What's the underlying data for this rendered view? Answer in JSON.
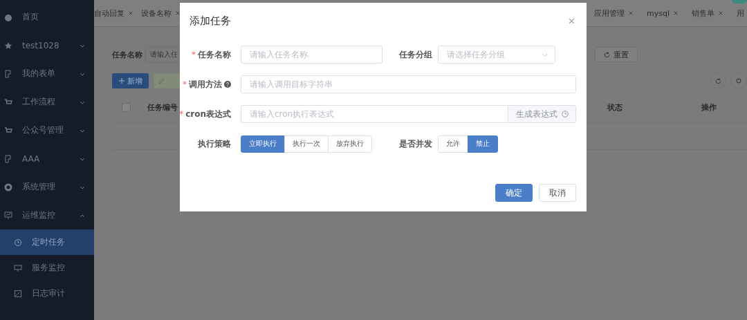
{
  "sidebar": {
    "items": [
      {
        "label": "首页"
      },
      {
        "label": "test1028",
        "expanded": false
      },
      {
        "label": "我的表单",
        "expanded": false
      },
      {
        "label": "工作流程",
        "expanded": false
      },
      {
        "label": "公众号管理",
        "expanded": false
      },
      {
        "label": "AAA",
        "expanded": false
      },
      {
        "label": "系统管理",
        "expanded": false
      },
      {
        "label": "运维监控",
        "expanded": true,
        "children": [
          {
            "label": "定时任务",
            "selected": true
          },
          {
            "label": "服务监控",
            "selected": false
          },
          {
            "label": "日志审计",
            "selected": false
          }
        ]
      }
    ]
  },
  "tabs_start": [
    {
      "label": "自动回复"
    },
    {
      "label": "设备名称"
    }
  ],
  "tabs_end": [
    {
      "label": "应用管理"
    },
    {
      "label": "mysql"
    },
    {
      "label": "销售单"
    },
    {
      "label": "用"
    }
  ],
  "search": {
    "label": "任务名称",
    "placeholder": "请输入任"
  },
  "reset_button": "重置",
  "add_button": "新增",
  "table": {
    "select_all_checked": false,
    "columns": [
      "任务编号",
      "状态",
      "操作"
    ]
  },
  "dialog": {
    "title": "添加任务",
    "rows": [
      [
        {
          "kind": "input",
          "required_mark": "*",
          "label": "任务名称",
          "help": false,
          "placeholder": "请输入任务名称"
        },
        {
          "kind": "select",
          "label": "任务分组",
          "help": false,
          "placeholder": "请选择任务分组"
        }
      ],
      [
        {
          "kind": "input",
          "required_mark": "*",
          "label": "调用方法",
          "help": true,
          "placeholder": "请输入调用目标字符串"
        }
      ],
      [
        {
          "kind": "input_append",
          "required_mark": "*",
          "label": "cron表达式",
          "help": false,
          "placeholder": "请输入cron执行表达式",
          "append": "生成表达式"
        }
      ],
      [
        {
          "kind": "radio_buttons",
          "label": "执行策略",
          "help": false,
          "options": [
            {
              "label": "立即执行",
              "selected": true
            },
            {
              "label": "执行一次",
              "selected": false
            },
            {
              "label": "放弃执行",
              "selected": false
            }
          ]
        },
        {
          "kind": "radio_buttons",
          "label": "是否并发",
          "help": false,
          "options": [
            {
              "label": "允许",
              "selected": false
            },
            {
              "label": "禁止",
              "selected": true
            }
          ]
        }
      ]
    ],
    "buttons": [
      {
        "label": "确定",
        "kind": "primary"
      },
      {
        "label": "取消",
        "kind": "default"
      }
    ]
  }
}
